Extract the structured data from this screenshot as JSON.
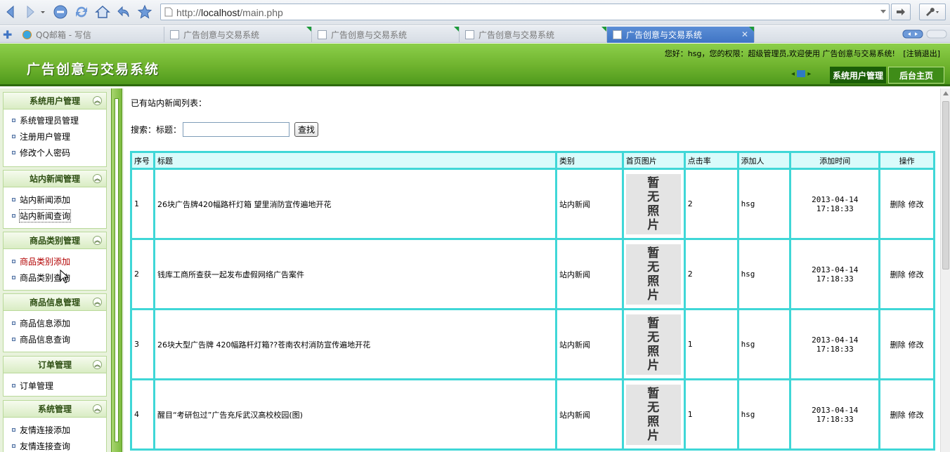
{
  "browser": {
    "url_prefix": "http://",
    "url_host": "localhost",
    "url_path": "/main.php",
    "tabs": [
      {
        "label": "QQ邮箱 - 写信"
      },
      {
        "label": "广告创意与交易系统"
      },
      {
        "label": "广告创意与交易系统"
      },
      {
        "label": "广告创意与交易系统"
      },
      {
        "label": "广告创意与交易系统"
      }
    ],
    "close_glyph": "✕"
  },
  "header": {
    "site_title": "广告创意与交易系统",
    "welcome": "您好：hsg，您的权限：超级管理员,欢迎使用 广告创意与交易系统!",
    "logout": "[注销退出]",
    "tab_current": "系统用户管理",
    "tab_home": "后台主页"
  },
  "sidebar": {
    "groups": [
      {
        "title": "系统用户管理",
        "items": [
          "系统管理员管理",
          "注册用户管理",
          "修改个人密码"
        ]
      },
      {
        "title": "站内新闻管理",
        "items": [
          "站内新闻添加",
          "站内新闻查询"
        ]
      },
      {
        "title": "商品类别管理",
        "items": [
          "商品类别添加",
          "商品类别查询"
        ]
      },
      {
        "title": "商品信息管理",
        "items": [
          "商品信息添加",
          "商品信息查询"
        ]
      },
      {
        "title": "订单管理",
        "items": [
          "订单管理"
        ]
      },
      {
        "title": "系统管理",
        "items": [
          "友情连接添加",
          "友情连接查询"
        ]
      }
    ]
  },
  "main": {
    "list_title": "已有站内新闻列表：",
    "search_label": "搜索：标题：",
    "search_value": "",
    "search_button": "查找",
    "columns": [
      "序号",
      "标题",
      "类别",
      "首页图片",
      "点击率",
      "添加人",
      "添加时间",
      "操作"
    ],
    "no_photo": [
      "暂",
      "无",
      "照",
      "片"
    ],
    "delete_label": "删除",
    "edit_label": "修改",
    "rows": [
      {
        "no": "1",
        "title": "26块广告牌420幅路杆灯箱 望里消防宣传遍地开花",
        "category": "站内新闻",
        "clicks": "2",
        "author": "hsg",
        "time": "2013-04-14 17:18:33"
      },
      {
        "no": "2",
        "title": "钱库工商所查获一起发布虚假网络广告案件",
        "category": "站内新闻",
        "clicks": "2",
        "author": "hsg",
        "time": "2013-04-14 17:18:33"
      },
      {
        "no": "3",
        "title": "26块大型广告牌 420幅路杆灯箱??苍南农村消防宣传遍地开花",
        "category": "站内新闻",
        "clicks": "1",
        "author": "hsg",
        "time": "2013-04-14 17:18:33"
      },
      {
        "no": "4",
        "title": "醒目“考研包过”广告充斥武汉高校校园(图)",
        "category": "站内新闻",
        "clicks": "1",
        "author": "hsg",
        "time": "2013-04-14 17:18:33"
      }
    ]
  }
}
